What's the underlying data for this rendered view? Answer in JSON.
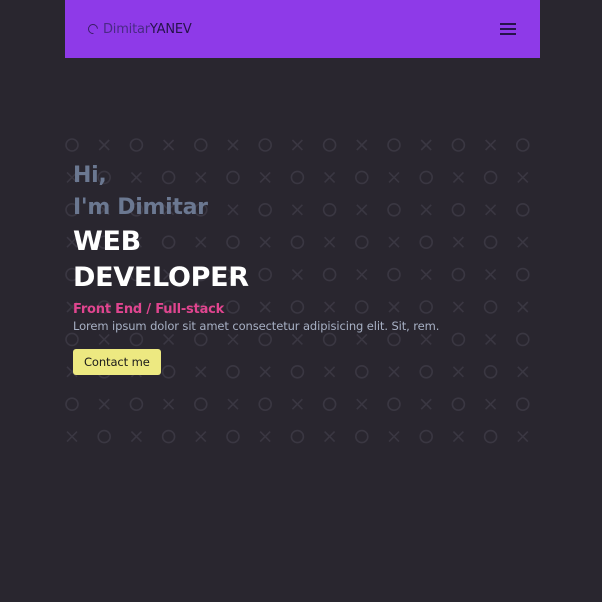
{
  "navbar": {
    "logo_first": "Dimitar",
    "logo_last": "YANEV",
    "logo_icon": "spinner-circle-icon",
    "menu_icon": "hamburger-menu-icon",
    "background_color": "#8e3ae8"
  },
  "hero": {
    "greeting_line1": "Hi,",
    "greeting_line2": "I'm Dimitar",
    "title_line1": "WEB",
    "title_line2": "DEVELOPER",
    "subtitle": "Front End / Full-stack",
    "description": "Lorem ipsum dolor sit amet consectetur adipisicing elit. Sit, rem.",
    "cta_label": "Contact me"
  },
  "pattern": {
    "symbols": [
      "O",
      "X"
    ],
    "color": "#3a3742"
  },
  "colors": {
    "page_background": "#29262f",
    "accent_pink": "#e0458f",
    "button_yellow": "#ede981"
  }
}
